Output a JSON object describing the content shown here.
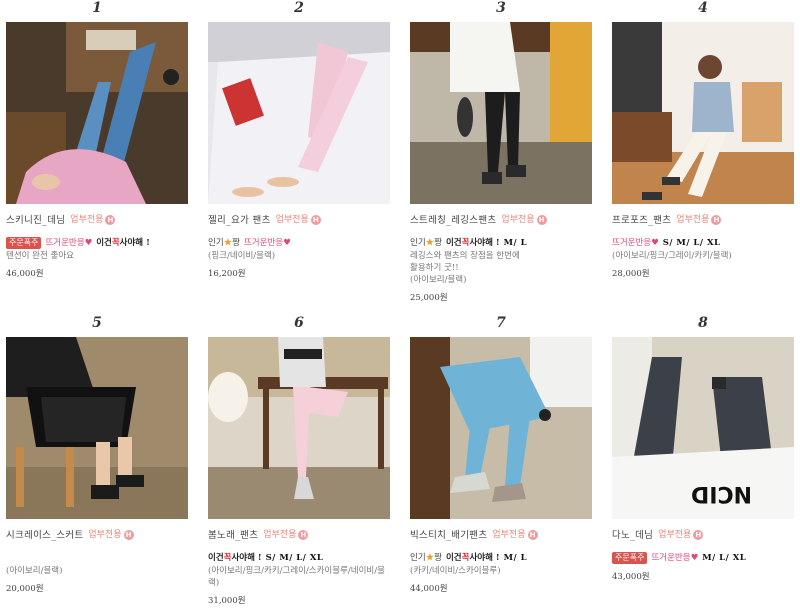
{
  "colors": {
    "exclusive_badge": "#e8877a",
    "must_box": "#d9534f",
    "pink_tag": "#e0457b",
    "star": "#f0a020",
    "must_red": "#e0303a"
  },
  "products": [
    {
      "rank": "1",
      "name": "스키니진_데님",
      "exclusive": "업부전용",
      "tag_box": "주문폭주",
      "tag_pink": "뜨거운반응",
      "tag_must": [
        "이건",
        "꼭",
        "사야해 !"
      ],
      "desc": "텐션이 완전 좋아요",
      "price": "46,000원"
    },
    {
      "rank": "2",
      "name": "젤리_요가 팬츠",
      "exclusive": "업부전용",
      "tag_hot": "인기",
      "tag_hot_suffix": "짱",
      "tag_pink": "뜨거운반응",
      "desc": "(핑크/네이비/블랙)",
      "price": "16,200원"
    },
    {
      "rank": "3",
      "name": "스트레칭_레깅스팬츠",
      "exclusive": "업부전용",
      "tag_hot": "인기",
      "tag_hot_suffix": "짱",
      "tag_must": [
        "이건",
        "꼭",
        "사야해 !"
      ],
      "sizes": "M/ L",
      "desc": "레깅스와 팬츠의 장점을 한번에\n활용하기 굿!!\n(아이보리/블랙)",
      "price": "25,000원"
    },
    {
      "rank": "4",
      "name": "프로포즈_팬츠",
      "exclusive": "업부전용",
      "tag_pink": "뜨거운반응",
      "sizes": "S/ M/ L/ XL",
      "desc": "(아이보리/핑크/그레이/카키/블랙)",
      "price": "28,000원"
    },
    {
      "rank": "5",
      "name": "시크레이스_스커트",
      "exclusive": "업부전용",
      "desc": "(아이보리/블랙)",
      "price": "20,000원"
    },
    {
      "rank": "6",
      "name": "봄노래_팬츠",
      "exclusive": "업부전용",
      "tag_must": [
        "이건",
        "꼭",
        "사야해 !"
      ],
      "sizes": "S/ M/ L/ XL",
      "desc": "(아이보리/핑크/카키/그레이/스카이블루/네이비/블랙)",
      "price": "31,000원"
    },
    {
      "rank": "7",
      "name": "빅스티치_배기팬츠",
      "exclusive": "업부전용",
      "tag_hot": "인기",
      "tag_hot_suffix": "짱",
      "tag_must": [
        "이건",
        "꼭",
        "사야해 !"
      ],
      "sizes": "M/ L",
      "desc": "(카키/네이비/스카이블루)",
      "price": "44,000원"
    },
    {
      "rank": "8",
      "name": "다노_데님",
      "exclusive": "업부전용",
      "tag_box": "주문폭주",
      "tag_pink": "뜨거운반응",
      "sizes": "M/ L/ XL",
      "price": "43,000원"
    }
  ]
}
